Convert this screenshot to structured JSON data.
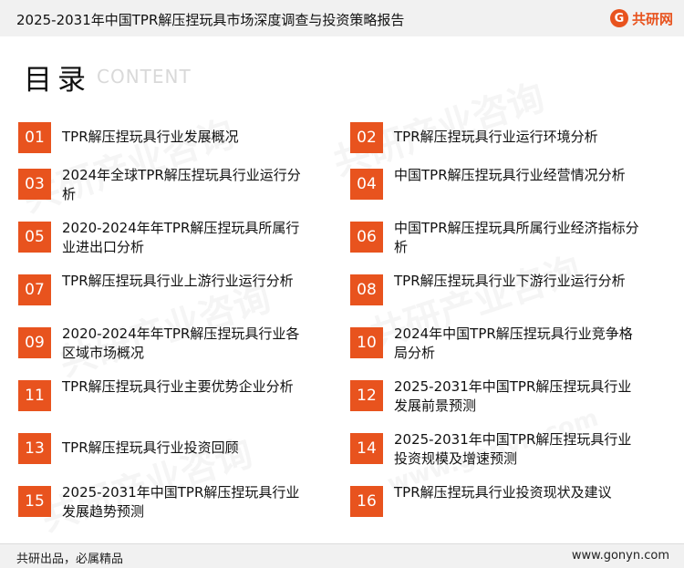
{
  "header": {
    "title": "2025-2031年中国TPR解压捏玩具市场深度调查与投资策略报告",
    "logo_mark": "G",
    "logo_text": "共研网"
  },
  "toc": {
    "title": "目录",
    "subtitle": "CONTENT",
    "items": [
      {
        "num": "01",
        "label": "TPR解压捏玩具行业发展概况"
      },
      {
        "num": "02",
        "label": "TPR解压捏玩具行业运行环境分析"
      },
      {
        "num": "03",
        "label": "2024年全球TPR解压捏玩具行业运行分析"
      },
      {
        "num": "04",
        "label": "中国TPR解压捏玩具行业经营情况分析"
      },
      {
        "num": "05",
        "label": "2020-2024年年TPR解压捏玩具所属行业进出口分析"
      },
      {
        "num": "06",
        "label": "中国TPR解压捏玩具所属行业经济指标分析"
      },
      {
        "num": "07",
        "label": "TPR解压捏玩具行业上游行业运行分析"
      },
      {
        "num": "08",
        "label": "TPR解压捏玩具行业下游行业运行分析"
      },
      {
        "num": "09",
        "label": "2020-2024年年TPR解压捏玩具行业各区域市场概况"
      },
      {
        "num": "10",
        "label": "2024年中国TPR解压捏玩具行业竞争格局分析"
      },
      {
        "num": "11",
        "label": "TPR解压捏玩具行业主要优势企业分析"
      },
      {
        "num": "12",
        "label": "2025-2031年中国TPR解压捏玩具行业发展前景预测"
      },
      {
        "num": "13",
        "label": "TPR解压捏玩具行业投资回顾"
      },
      {
        "num": "14",
        "label": "2025-2031年中国TPR解压捏玩具行业投资规模及增速预测"
      },
      {
        "num": "15",
        "label": "2025-2031年中国TPR解压捏玩具行业发展趋势预测"
      },
      {
        "num": "16",
        "label": "TPR解压捏玩具行业投资现状及建议"
      }
    ]
  },
  "footer": {
    "left": "共研出品，必属精品",
    "right": "www.gonyn.com"
  },
  "watermark": {
    "text": "共研产业咨询",
    "url": "www.gonyn.com"
  },
  "colors": {
    "accent": "#e8531e",
    "header_bg": "#f1f1f1"
  }
}
